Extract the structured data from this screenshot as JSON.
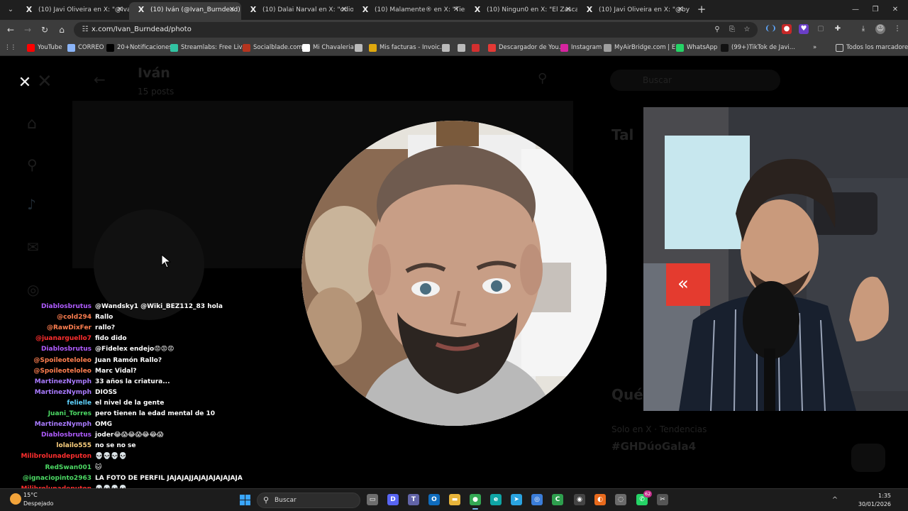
{
  "browser": {
    "tabs": [
      {
        "label": "(10) Javi Oliveira en X: \"@Ivan_Bu",
        "active": false
      },
      {
        "label": "(10) Iván (@Ivan_Burndead) / X",
        "active": true
      },
      {
        "label": "(10) Dalai Narval en X: \"odio la",
        "active": false
      },
      {
        "label": "(10) Malamente® en X: \"Tienes",
        "active": false
      },
      {
        "label": "(10) Ningun0 en X: \"El Zasca qu",
        "active": false
      },
      {
        "label": "(10) Javi Oliveira en X: \"@bycal",
        "active": false
      }
    ],
    "tab_favicon": "X",
    "url": "x.com/Ivan_Burndead/photo",
    "bookmarks": [
      {
        "label": "YouTube",
        "icon": "youtube-icon",
        "color": "#ff0000"
      },
      {
        "label": "CORREO",
        "icon": "mail-icon",
        "color": "#8ab4f8"
      },
      {
        "label": "20+Notificaciones",
        "icon": "x-icon",
        "color": "#000000"
      },
      {
        "label": "Streamlabs: Free Liv...",
        "icon": "streamlabs-icon",
        "color": "#31c3a2"
      },
      {
        "label": "Socialblade.com",
        "icon": "socialblade-icon",
        "color": "#b5341e"
      },
      {
        "label": "Mi Chavaleria",
        "icon": "github-icon",
        "color": "#ffffff"
      },
      {
        "label": "",
        "icon": "globe-icon",
        "color": "#bbbbbb"
      },
      {
        "label": "Mis facturas - Invoic...",
        "icon": "invoice-icon",
        "color": "#e0a80d"
      },
      {
        "label": "",
        "icon": "globe-icon",
        "color": "#bbbbbb"
      },
      {
        "label": "",
        "icon": "globe-icon",
        "color": "#bbbbbb"
      },
      {
        "label": "",
        "icon": "red-icon",
        "color": "#d32f2f"
      },
      {
        "label": "Descargador de You...",
        "icon": "download-icon",
        "color": "#e53935"
      },
      {
        "label": "Instagram",
        "icon": "instagram-icon",
        "color": "#d6249f"
      },
      {
        "label": "MyAirBridge.com | E...",
        "icon": "cloud-icon",
        "color": "#9e9e9e"
      },
      {
        "label": "WhatsApp",
        "icon": "whatsapp-icon",
        "color": "#25d366"
      },
      {
        "label": "(99+)TikTok de Javi...",
        "icon": "tiktok-icon",
        "color": "#111111"
      }
    ],
    "bookmarks_more": "»",
    "all_bookmarks": "Todos los marcadores"
  },
  "page": {
    "close_label": "✕",
    "background_profile": {
      "name": "Iván",
      "posts": "15 posts",
      "search_placeholder": "Buscar",
      "whats_happening": "Qué",
      "trend_meta": "Solo en X · Tendencias",
      "trend_tag": "#GHDúoGala4",
      "trend_heading": "Tal"
    }
  },
  "chat": {
    "messages": [
      {
        "user": "Diablosbrutus",
        "text": "@Wandsky1 @Wiki_BEZ112_83 hola",
        "color": "#b05cff"
      },
      {
        "user": "@cold294",
        "text": "Rallo",
        "color": "#ff7f50"
      },
      {
        "user": "@RawDixFer",
        "text": "rallo?",
        "color": "#ff7f50"
      },
      {
        "user": "@juanarguello7",
        "text": "fido dido",
        "color": "#ff2e2e"
      },
      {
        "user": "Diablosbrutus",
        "text": "@Fidelex endejo😡😡😡",
        "color": "#b05cff"
      },
      {
        "user": "@Spoileoteloleo",
        "text": "Juan Ramón Rallo?",
        "color": "#ff7f50"
      },
      {
        "user": "@Spoileoteloleo",
        "text": "Marc Vidal?",
        "color": "#ff7f50"
      },
      {
        "user": "MartinezNymph",
        "text": "33 años la criatura...",
        "color": "#a97bff"
      },
      {
        "user": "MartinezNymph",
        "text": "DIOSS",
        "color": "#a97bff"
      },
      {
        "user": "felielle",
        "text": "el nivel de la gente",
        "color": "#5fd3ff"
      },
      {
        "user": "Juani_Torres",
        "text": "pero tienen la edad mental de 10",
        "color": "#4cd964"
      },
      {
        "user": "MartinezNymph",
        "text": "OMG",
        "color": "#a97bff"
      },
      {
        "user": "Diablosbrutus",
        "text": "joder😂😱😂😱😂😂😱",
        "color": "#b05cff"
      },
      {
        "user": "lolailo555",
        "text": "no se no se",
        "color": "#ffd27f"
      },
      {
        "user": "Milibrolunadeputon",
        "text": "💀💀💀💀",
        "color": "#ff2e2e"
      },
      {
        "user": "RedSwan001",
        "text": "🐱",
        "color": "#4cd964"
      },
      {
        "user": "@ignaciopinto2963",
        "text": "LA FOTO DE PERFIL JAJAJAJJAJAJAJAJAJAJA",
        "color": "#4cd964"
      },
      {
        "user": "Milibrolunadeputon",
        "text": "💀💀💀💀",
        "color": "#ff2e2e"
      },
      {
        "user": "RedSwan001",
        "text": "🐱",
        "color": "#4cd964"
      }
    ]
  },
  "taskbar": {
    "temp": "15°C",
    "weather": "Despejado",
    "search_label": "Buscar",
    "time": "1:35",
    "date": "30/01/2026",
    "apps": [
      {
        "name": "task-view",
        "color": "#6e6e6e",
        "glyph": "▭"
      },
      {
        "name": "discord",
        "color": "#5865f2",
        "glyph": "D"
      },
      {
        "name": "teams",
        "color": "#6264a7",
        "glyph": "T"
      },
      {
        "name": "outlook",
        "color": "#0f6cbd",
        "glyph": "O"
      },
      {
        "name": "file-explorer",
        "color": "#e8b43a",
        "glyph": "▬"
      },
      {
        "name": "chrome",
        "color": "#34a853",
        "glyph": "●",
        "active": true
      },
      {
        "name": "edge",
        "color": "#0fa5a5",
        "glyph": "e"
      },
      {
        "name": "telegram",
        "color": "#2aa3e0",
        "glyph": "➤"
      },
      {
        "name": "browser-globe",
        "color": "#3b7dd8",
        "glyph": "◎"
      },
      {
        "name": "green-app",
        "color": "#2e9f4e",
        "glyph": "C"
      },
      {
        "name": "obs",
        "color": "#444444",
        "glyph": "◉"
      },
      {
        "name": "orange-app",
        "color": "#e86a1c",
        "glyph": "◐"
      },
      {
        "name": "media-app",
        "color": "#6b6b6b",
        "glyph": "◌"
      },
      {
        "name": "whatsapp",
        "color": "#25d366",
        "glyph": "✆",
        "badge": "62"
      },
      {
        "name": "snipping-tool",
        "color": "#555555",
        "glyph": "✂"
      }
    ]
  }
}
